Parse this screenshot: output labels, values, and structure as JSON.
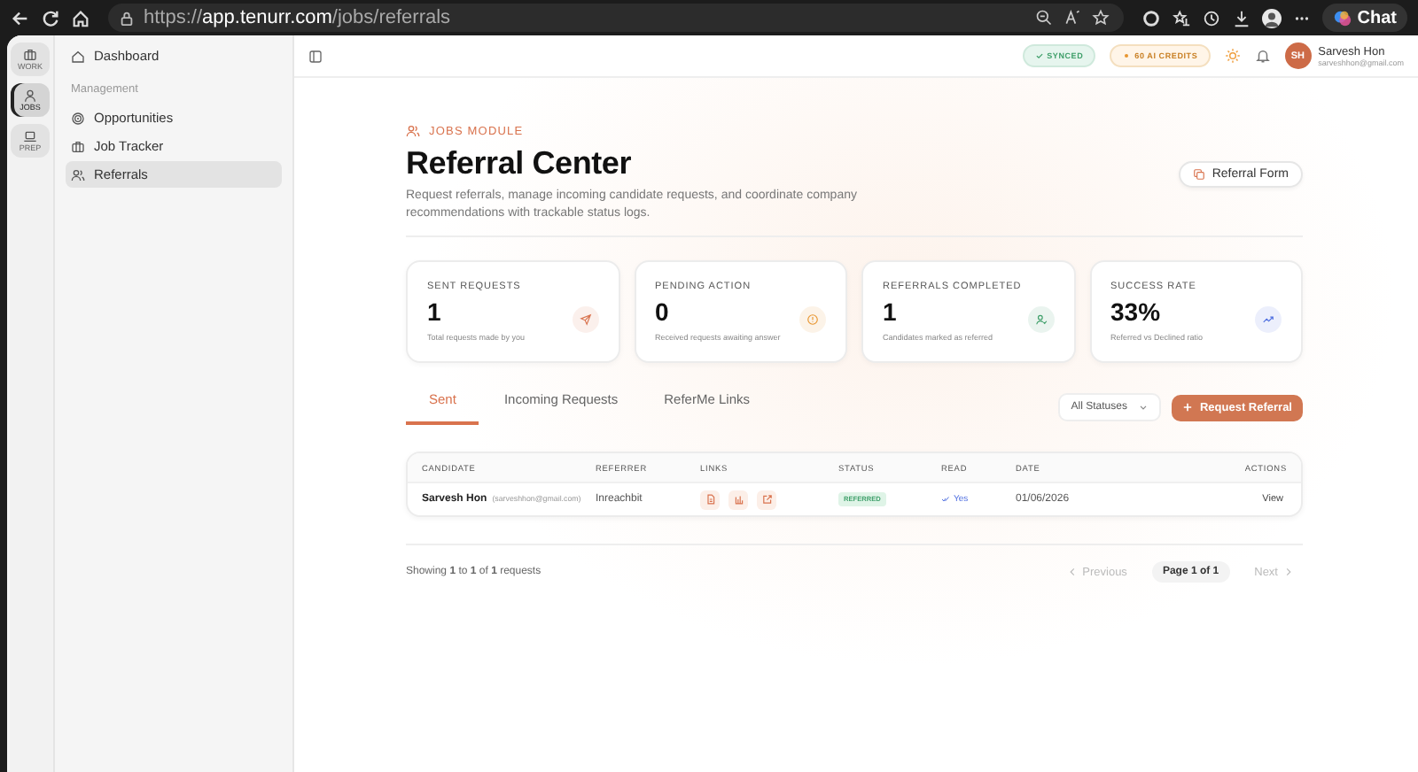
{
  "browser": {
    "url": [
      {
        "text": "https://",
        "strong": false
      },
      {
        "text": "app.tenurr.com",
        "strong": true
      },
      {
        "text": "/jobs/referrals",
        "strong": false
      }
    ],
    "chat": "Chat"
  },
  "rail": [
    {
      "label": "WORK",
      "selected": false
    },
    {
      "label": "JOBS",
      "selected": true
    },
    {
      "label": "PREP",
      "selected": false
    }
  ],
  "sidebar": {
    "items": [
      {
        "kind": "item",
        "label": "Dashboard",
        "selected": false
      },
      {
        "kind": "section",
        "label": "Management"
      },
      {
        "kind": "item",
        "label": "Opportunities",
        "selected": false
      },
      {
        "kind": "item",
        "label": "Job Tracker",
        "selected": false
      },
      {
        "kind": "item",
        "label": "Referrals",
        "selected": true
      }
    ]
  },
  "header": {
    "badges": [
      {
        "label": "SYNCED",
        "kind": "synced"
      },
      {
        "label": "60 AI CREDITS",
        "kind": "credits"
      }
    ],
    "user": {
      "initials": "SH",
      "name": "Sarvesh Hon",
      "email": "sarveshhon@gmail.com"
    }
  },
  "page": {
    "eyebrow": "JOBS MODULE",
    "title": "Referral Center",
    "description": "Request referrals, manage incoming candidate requests, and coordinate company recommendations with trackable status logs.",
    "form_button": "Referral Form"
  },
  "stats": [
    {
      "label": "SENT REQUESTS",
      "value": "1",
      "note": "Total requests made by you",
      "color": "#d9734e"
    },
    {
      "label": "PENDING ACTION",
      "value": "0",
      "note": "Received requests awaiting answer",
      "color": "#e8952f"
    },
    {
      "label": "REFERRALS COMPLETED",
      "value": "1",
      "note": "Candidates marked as referred",
      "color": "#3f9f6a"
    },
    {
      "label": "SUCCESS RATE",
      "value": "33%",
      "note": "Referred vs Declined ratio",
      "color": "#4f6fe0"
    }
  ],
  "tabs": [
    {
      "label": "Sent",
      "selected": true
    },
    {
      "label": "Incoming Requests",
      "selected": false
    },
    {
      "label": "ReferMe Links",
      "selected": false
    }
  ],
  "filter": {
    "value": "All Statuses"
  },
  "request_button": "Request Referral",
  "table": {
    "columns": [
      "CANDIDATE",
      "REFERRER",
      "LINKS",
      "STATUS",
      "READ",
      "DATE",
      "ACTIONS"
    ],
    "rows": [
      {
        "name": "Sarvesh Hon",
        "email": "(sarveshhon@gmail.com)",
        "referrer": "Inreachbit",
        "status": "REFERRED",
        "read": "Yes",
        "date": "01/06/2026",
        "action": "View"
      }
    ]
  },
  "footer": {
    "summary": "Showing **1** to **1** of **1** requests",
    "previous": "Previous",
    "page": "Page 1 of 1",
    "next": "Next",
    "previous_disabled": true,
    "next_disabled": true
  }
}
